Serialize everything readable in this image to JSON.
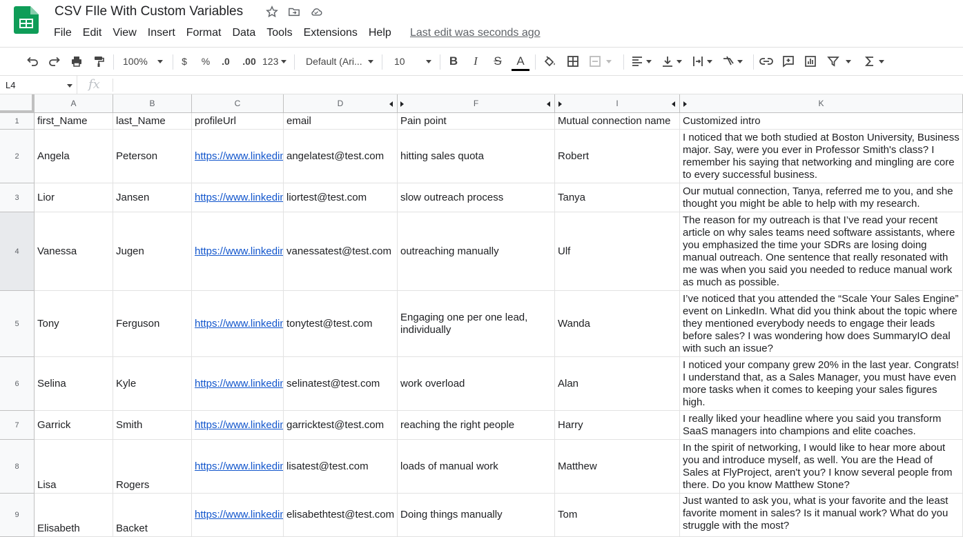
{
  "doc": {
    "title": "CSV FIle With Custom Variables",
    "last_edit": "Last edit was seconds ago"
  },
  "menu": [
    "File",
    "Edit",
    "View",
    "Insert",
    "Format",
    "Data",
    "Tools",
    "Extensions",
    "Help"
  ],
  "toolbar": {
    "zoom": "100%",
    "currency": "$",
    "percent": "%",
    "dec_decrease": ".0",
    "dec_increase": ".00",
    "more_formats": "123",
    "font": "Default (Ari...",
    "font_size": "10",
    "bold": "B",
    "italic": "I",
    "strike": "S",
    "text_color": "A"
  },
  "formula_bar": {
    "cell_ref": "L4",
    "fx": "fx",
    "content": ""
  },
  "columns": [
    "A",
    "B",
    "C",
    "D",
    "F",
    "I",
    "K"
  ],
  "rows": [
    {
      "num": "1",
      "cells": [
        "first_Name",
        "last_Name",
        "profileUrl",
        "email",
        "Pain point",
        "Mutual connection name",
        "Customized intro"
      ]
    },
    {
      "num": "2",
      "cells": [
        "Angela",
        "Peterson",
        "https://www.linkedin.com/in/",
        "angelatest@test.com",
        "hitting sales quota",
        "Robert",
        "I noticed that we both studied at Boston University, Business major. Say, were you ever in Professor Smith's class? I remember his saying that networking and mingling are core to every successful business."
      ]
    },
    {
      "num": "3",
      "cells": [
        "Lior",
        "Jansen",
        "https://www.linkedin.com/in/",
        "liortest@test.com",
        "slow outreach process",
        "Tanya",
        "Our mutual connection, Tanya, referred me to you, and she thought you might be able to help with my research."
      ]
    },
    {
      "num": "4",
      "cells": [
        "Vanessa",
        "Jugen",
        "https://www.linkedin.com/in/",
        "vanessatest@test.com",
        "outreaching manually",
        "Ulf",
        "The reason for my outreach is that I’ve read your recent article on why sales teams need software assistants, where you emphasized the time your SDRs are losing doing manual outreach. One sentence that really resonated with me was when you said you needed to reduce manual work as much as possible."
      ]
    },
    {
      "num": "5",
      "cells": [
        "Tony",
        "Ferguson",
        "https://www.linkedin.com/in/",
        "tonytest@test.com",
        "Engaging one per one lead, individually",
        "Wanda",
        "I’ve noticed that you attended the “Scale Your Sales Engine” event on LinkedIn. What did you think about the topic where they mentioned everybody needs to engage their leads before sales? I was wondering how does SummaryIO deal with such an issue?"
      ]
    },
    {
      "num": "6",
      "cells": [
        "Selina",
        "Kyle",
        "https://www.linkedin.com/in/",
        "selinatest@test.com",
        "work overload",
        "Alan",
        "I noticed your company grew 20% in the last year. Congrats! I understand that, as a Sales Manager, you must have even more tasks when it comes to keeping your sales figures high."
      ]
    },
    {
      "num": "7",
      "cells": [
        "Garrick",
        "Smith",
        "https://www.linkedin.com/in/",
        "garricktest@test.com",
        "reaching the right people",
        "Harry",
        "I really liked your headline where you said you transform SaaS managers into champions and elite coaches."
      ]
    },
    {
      "num": "8",
      "cells": [
        "Lisa",
        "Rogers",
        "https://www.linkedin.com/in/",
        "lisatest@test.com",
        "loads of manual work",
        "Matthew",
        "In the spirit of networking, I would like to hear more about you and introduce myself, as well. You are the Head of Sales at FlyProject, aren't you? I know several people from there. Do you know Matthew Stone?"
      ]
    },
    {
      "num": "9",
      "cells": [
        "Elisabeth",
        "Backet",
        "https://www.linkedin.com/in/",
        "elisabethtest@test.com",
        "Doing things manually",
        "Tom",
        "Just wanted to ask you, what is your favorite and the least favorite moment in sales? Is it manual work? What do you struggle with the most?"
      ]
    }
  ],
  "colors": {
    "link": "#1155cc",
    "logo_green": "#0f9d58",
    "header_bg": "#f8f9fa",
    "grid_line": "#e2e2e2"
  }
}
